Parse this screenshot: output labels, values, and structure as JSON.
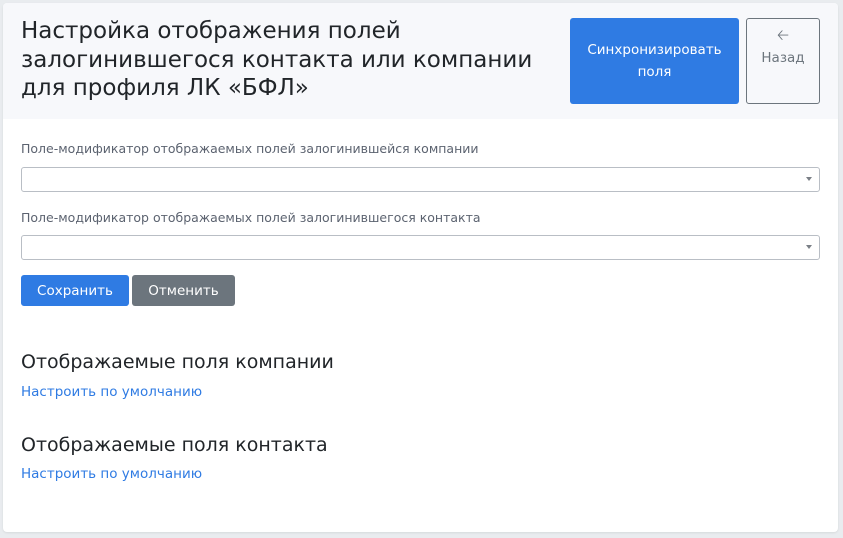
{
  "header": {
    "title": "Настройка отображения полей залогинившегося контакта или компании для профиля ЛК «БФЛ»",
    "sync_button": "Синхронизировать поля",
    "back_button": "Назад",
    "back_icon": "arrow-left-icon"
  },
  "form": {
    "company_field_label": "Поле-модификатор отображаемых полей залогинившейся компании",
    "company_field_value": "",
    "contact_field_label": "Поле-модификатор отображаемых полей залогинившегося контакта",
    "contact_field_value": "",
    "save_button": "Сохранить",
    "cancel_button": "Отменить"
  },
  "sections": {
    "company": {
      "title": "Отображаемые поля компании",
      "link": "Настроить по умолчанию"
    },
    "contact": {
      "title": "Отображаемые поля контакта",
      "link": "Настроить по умолчанию"
    }
  },
  "colors": {
    "primary": "#2f7be3",
    "secondary": "#6c757d",
    "header_bg": "#f7f8fb"
  }
}
